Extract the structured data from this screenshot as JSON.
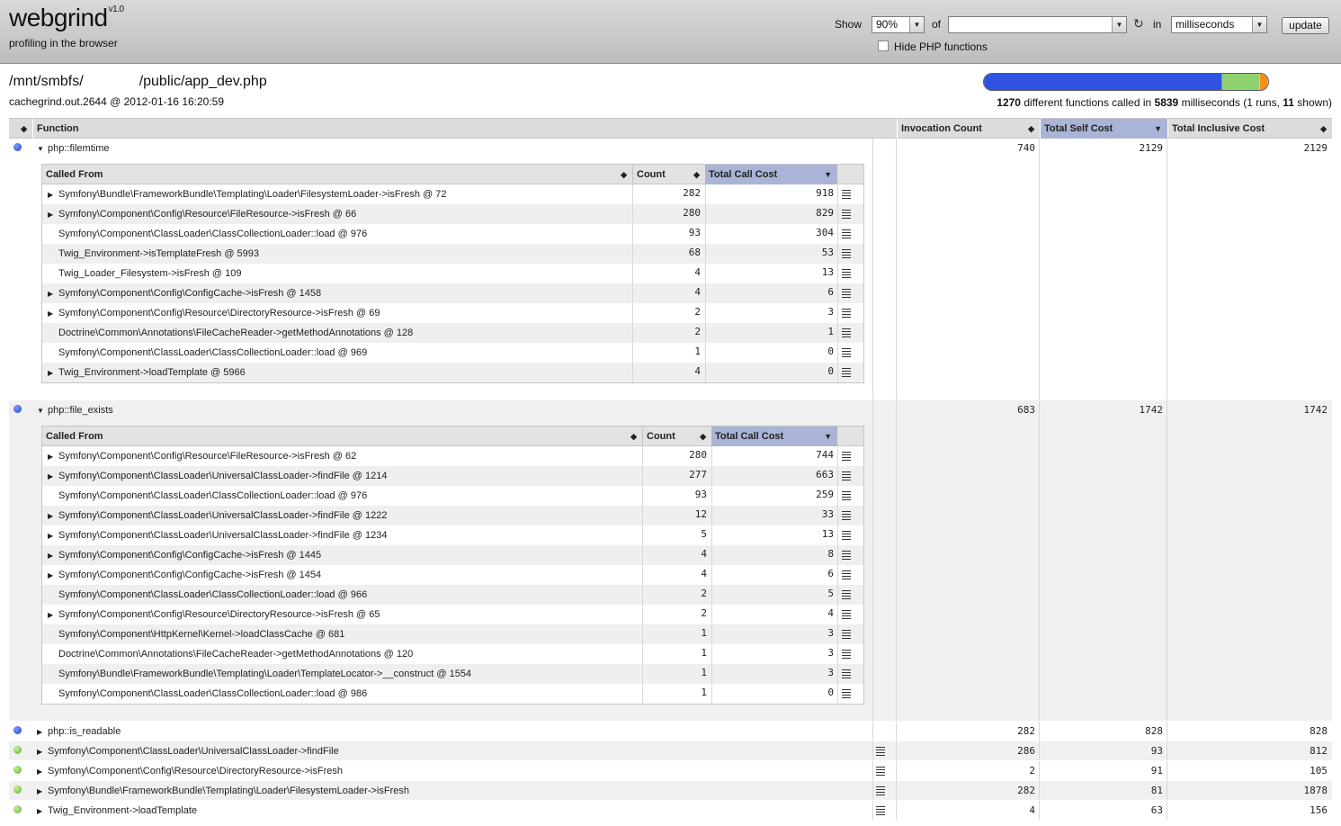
{
  "app": {
    "logo": "webgrind",
    "version": "v1.0",
    "tagline": "profiling in the browser"
  },
  "controls": {
    "show_label": "Show",
    "percent": "90%",
    "of_label": "of",
    "file_value": "",
    "in_label": "in",
    "unit": "milliseconds",
    "update_label": "update",
    "hide_php_label": "Hide PHP functions",
    "hide_php_checked": false
  },
  "info": {
    "path_part1": "/mnt/smbfs/",
    "path_part2": "/public/app_dev.php",
    "cachefile": "cachegrind.out.2644 @ 2012-01-16 16:20:59",
    "functions_count": "1270",
    "summary_mid": " different functions called in ",
    "milliseconds": "5839",
    "summary_end": " milliseconds (1 runs, ",
    "shown": "11",
    "summary_tail": " shown)",
    "bar_segments": [
      {
        "color": "#2f52e0",
        "fraction": 0.84
      },
      {
        "color": "#8fd070",
        "fraction": 0.13
      },
      {
        "color": "#f39018",
        "fraction": 0.03
      }
    ]
  },
  "columns": {
    "function": "Function",
    "invocation": "Invocation Count",
    "self": "Total Self Cost",
    "inclusive": "Total Inclusive Cost"
  },
  "sub_columns": {
    "called_from": "Called From",
    "count": "Count",
    "total_call_cost": "Total Call Cost"
  },
  "functions": [
    {
      "name": "php::filemtime",
      "dot": "blue",
      "expanded": true,
      "has_file": false,
      "invocation": "740",
      "self": "2129",
      "inclusive": "2129",
      "callers": [
        {
          "name": "Symfony\\Bundle\\FrameworkBundle\\Templating\\Loader\\FilesystemLoader->isFresh @ 72",
          "arrow": true,
          "count": "282",
          "cost": "918"
        },
        {
          "name": "Symfony\\Component\\Config\\Resource\\FileResource->isFresh @ 66",
          "arrow": true,
          "count": "280",
          "cost": "829"
        },
        {
          "name": "Symfony\\Component\\ClassLoader\\ClassCollectionLoader::load @ 976",
          "arrow": false,
          "count": "93",
          "cost": "304"
        },
        {
          "name": "Twig_Environment->isTemplateFresh @ 5993",
          "arrow": false,
          "count": "68",
          "cost": "53"
        },
        {
          "name": "Twig_Loader_Filesystem->isFresh @ 109",
          "arrow": false,
          "count": "4",
          "cost": "13"
        },
        {
          "name": "Symfony\\Component\\Config\\ConfigCache->isFresh @ 1458",
          "arrow": true,
          "count": "4",
          "cost": "6"
        },
        {
          "name": "Symfony\\Component\\Config\\Resource\\DirectoryResource->isFresh @ 69",
          "arrow": true,
          "count": "2",
          "cost": "3"
        },
        {
          "name": "Doctrine\\Common\\Annotations\\FileCacheReader->getMethodAnnotations @ 128",
          "arrow": false,
          "count": "2",
          "cost": "1"
        },
        {
          "name": "Symfony\\Component\\ClassLoader\\ClassCollectionLoader::load @ 969",
          "arrow": false,
          "count": "1",
          "cost": "0"
        },
        {
          "name": "Twig_Environment->loadTemplate @ 5966",
          "arrow": true,
          "count": "4",
          "cost": "0"
        }
      ]
    },
    {
      "name": "php::file_exists",
      "dot": "blue",
      "expanded": true,
      "has_file": false,
      "invocation": "683",
      "self": "1742",
      "inclusive": "1742",
      "callers": [
        {
          "name": "Symfony\\Component\\Config\\Resource\\FileResource->isFresh @ 62",
          "arrow": true,
          "count": "280",
          "cost": "744"
        },
        {
          "name": "Symfony\\Component\\ClassLoader\\UniversalClassLoader->findFile @ 1214",
          "arrow": true,
          "count": "277",
          "cost": "663"
        },
        {
          "name": "Symfony\\Component\\ClassLoader\\ClassCollectionLoader::load @ 976",
          "arrow": false,
          "count": "93",
          "cost": "259"
        },
        {
          "name": "Symfony\\Component\\ClassLoader\\UniversalClassLoader->findFile @ 1222",
          "arrow": true,
          "count": "12",
          "cost": "33"
        },
        {
          "name": "Symfony\\Component\\ClassLoader\\UniversalClassLoader->findFile @ 1234",
          "arrow": true,
          "count": "5",
          "cost": "13"
        },
        {
          "name": "Symfony\\Component\\Config\\ConfigCache->isFresh @ 1445",
          "arrow": true,
          "count": "4",
          "cost": "8"
        },
        {
          "name": "Symfony\\Component\\Config\\ConfigCache->isFresh @ 1454",
          "arrow": true,
          "count": "4",
          "cost": "6"
        },
        {
          "name": "Symfony\\Component\\ClassLoader\\ClassCollectionLoader::load @ 966",
          "arrow": false,
          "count": "2",
          "cost": "5"
        },
        {
          "name": "Symfony\\Component\\Config\\Resource\\DirectoryResource->isFresh @ 65",
          "arrow": true,
          "count": "2",
          "cost": "4"
        },
        {
          "name": "Symfony\\Component\\HttpKernel\\Kernel->loadClassCache @ 681",
          "arrow": false,
          "count": "1",
          "cost": "3"
        },
        {
          "name": "Doctrine\\Common\\Annotations\\FileCacheReader->getMethodAnnotations @ 120",
          "arrow": false,
          "count": "1",
          "cost": "3"
        },
        {
          "name": "Symfony\\Bundle\\FrameworkBundle\\Templating\\Loader\\TemplateLocator->__construct @ 1554",
          "arrow": false,
          "count": "1",
          "cost": "3"
        },
        {
          "name": "Symfony\\Component\\ClassLoader\\ClassCollectionLoader::load @ 986",
          "arrow": false,
          "count": "1",
          "cost": "0"
        }
      ]
    },
    {
      "name": "php::is_readable",
      "dot": "blue",
      "expanded": false,
      "has_file": false,
      "invocation": "282",
      "self": "828",
      "inclusive": "828",
      "callers": []
    },
    {
      "name": "Symfony\\Component\\ClassLoader\\UniversalClassLoader->findFile",
      "dot": "green",
      "expanded": false,
      "has_file": true,
      "invocation": "286",
      "self": "93",
      "inclusive": "812",
      "callers": []
    },
    {
      "name": "Symfony\\Component\\Config\\Resource\\DirectoryResource->isFresh",
      "dot": "green",
      "expanded": false,
      "has_file": true,
      "invocation": "2",
      "self": "91",
      "inclusive": "105",
      "callers": []
    },
    {
      "name": "Symfony\\Bundle\\FrameworkBundle\\Templating\\Loader\\FilesystemLoader->isFresh",
      "dot": "green",
      "expanded": false,
      "has_file": true,
      "invocation": "282",
      "self": "81",
      "inclusive": "1878",
      "callers": []
    },
    {
      "name": "Twig_Environment->loadTemplate",
      "dot": "green",
      "expanded": false,
      "has_file": true,
      "invocation": "4",
      "self": "63",
      "inclusive": "156",
      "callers": []
    }
  ]
}
